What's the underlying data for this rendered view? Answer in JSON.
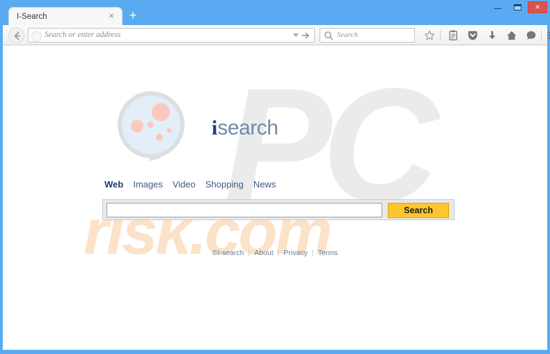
{
  "window": {
    "controls": {
      "minimize_label": "–",
      "maximize_label": "",
      "close_label": "×"
    },
    "chrome_color": "#5aaaf2",
    "close_color": "#d9534f"
  },
  "tabstrip": {
    "tabs": [
      {
        "title": "I-Search",
        "close_label": "×",
        "active": true
      }
    ],
    "new_tab_label": "+"
  },
  "toolbar": {
    "back_icon": "back-arrow-icon",
    "forward_icon": "forward-arrow-icon",
    "url_placeholder": "Search or enter address",
    "url_value": "",
    "url_dropdown_icon": "chevron-down-icon",
    "url_go_icon": "go-arrow-icon",
    "search_placeholder": "Search",
    "search_value": "",
    "search_icon": "magnifier-icon",
    "icons": [
      {
        "name": "star-bookmark-icon",
        "glyph": "☆"
      },
      {
        "name": "reading-list-icon",
        "glyph": "▤"
      },
      {
        "name": "pocket-save-icon",
        "glyph": "▼"
      },
      {
        "name": "downloads-icon",
        "glyph": "↓"
      },
      {
        "name": "home-icon",
        "glyph": "⌂"
      },
      {
        "name": "sync-chat-icon",
        "glyph": "●"
      },
      {
        "name": "hamburger-menu-icon",
        "glyph": "☰"
      }
    ]
  },
  "page": {
    "watermarks": {
      "primary": "PC",
      "secondary": "risk.com",
      "primary_color": "#ebebeb",
      "secondary_color": "#fbe2c8"
    },
    "logo": {
      "icon": "magnifying-glass-logo",
      "text_i": "i",
      "text_rest": "search",
      "lens_color": "#e3eef8",
      "ring_color": "#d8dcdf",
      "dot_color": "#fbc8c0",
      "i_color": "#1a3f7a",
      "search_color": "#6e8ca8"
    },
    "nav": [
      {
        "label": "Web",
        "active": true
      },
      {
        "label": "Images",
        "active": false
      },
      {
        "label": "Video",
        "active": false
      },
      {
        "label": "Shopping",
        "active": false
      },
      {
        "label": "News",
        "active": false
      }
    ],
    "search": {
      "input_value": "",
      "input_placeholder": "",
      "button_label": "Search",
      "button_color": "#fbc62e"
    },
    "footer": {
      "copyright": "©I-search",
      "separator": "|",
      "links": [
        {
          "label": "About"
        },
        {
          "label": "Privacy"
        },
        {
          "label": "Terms"
        }
      ]
    }
  }
}
